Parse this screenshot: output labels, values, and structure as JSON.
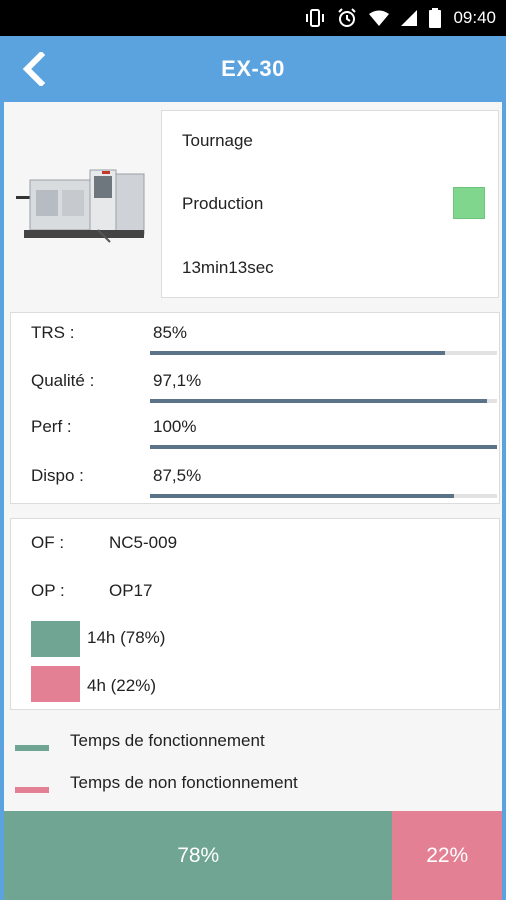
{
  "status_bar": {
    "time": "09:40",
    "icons": [
      "vibrate-icon",
      "alarm-icon",
      "wifi-icon",
      "signal-icon",
      "battery-icon"
    ]
  },
  "header": {
    "title": "EX-30",
    "back_icon": "back-chevron-icon",
    "color": "#5aa3df"
  },
  "machine": {
    "image_icon": "cnc-machine-image",
    "operation": "Tournage",
    "state": "Production",
    "state_color": "#7fd68c",
    "duration": "13min13sec"
  },
  "kpis": [
    {
      "label": "TRS :",
      "value": "85%",
      "fraction": 0.85
    },
    {
      "label": "Qualité :",
      "value": "97,1%",
      "fraction": 0.971
    },
    {
      "label": "Perf :",
      "value": "100%",
      "fraction": 1.0
    },
    {
      "label": "Dispo :",
      "value": "87,5%",
      "fraction": 0.875
    }
  ],
  "order": {
    "of_label": "OF :",
    "of_value": "NC5-009",
    "op_label": "OP :",
    "op_value": "OP17",
    "running_text": "14h (78%)",
    "stopped_text": "4h (22%)"
  },
  "legend": {
    "running": "Temps de fonctionnement",
    "stopped": "Temps de non fonctionnement"
  },
  "distribution": {
    "running_label": "78%",
    "running_fraction": 0.78,
    "stopped_label": "22%",
    "stopped_fraction": 0.22
  },
  "colors": {
    "running": "#6fa592",
    "stopped": "#e38093",
    "kpi_bar": "#5b7389"
  }
}
